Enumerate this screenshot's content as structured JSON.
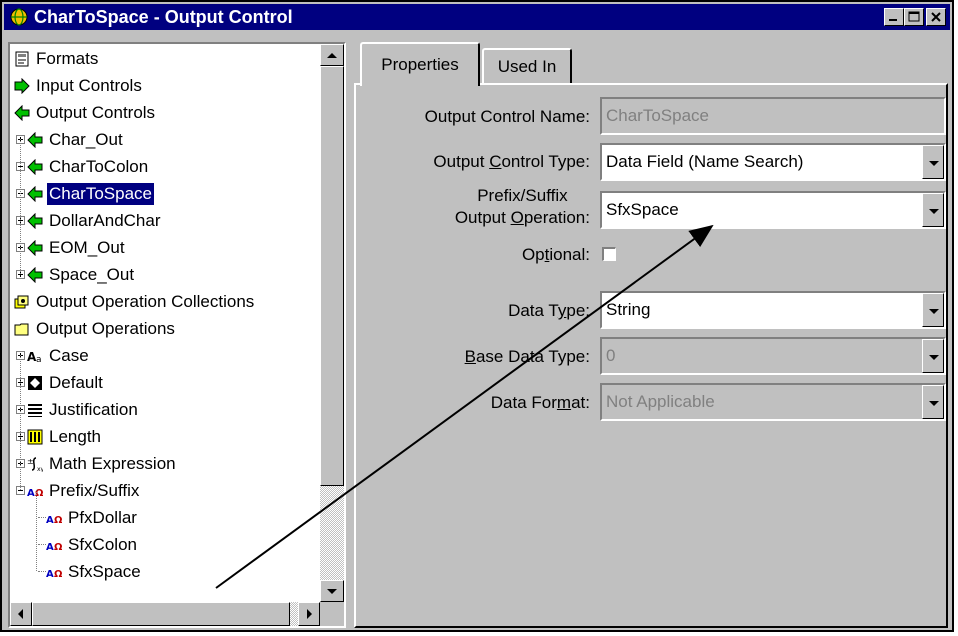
{
  "window": {
    "title": "CharToSpace - Output Control",
    "app_icon": "app-globe-icon",
    "controls": [
      "minimize-icon",
      "maximize-icon",
      "close-icon"
    ]
  },
  "tree": {
    "items": [
      {
        "label": "Formats",
        "icon": "formats-icon",
        "level": 0
      },
      {
        "label": "Input Controls",
        "icon": "input-controls-icon",
        "level": 0
      },
      {
        "label": "Output Controls",
        "icon": "output-controls-icon",
        "level": 0
      },
      {
        "label": "Char_Out",
        "icon": "output-control-icon",
        "level": 1,
        "expander": "plus"
      },
      {
        "label": "CharToColon",
        "icon": "output-control-icon",
        "level": 1,
        "expander": "minus"
      },
      {
        "label": "CharToSpace",
        "icon": "output-control-icon",
        "level": 1,
        "expander": "minus",
        "selected": true
      },
      {
        "label": "DollarAndChar",
        "icon": "output-control-icon",
        "level": 1,
        "expander": "plus"
      },
      {
        "label": "EOM_Out",
        "icon": "output-control-icon",
        "level": 1,
        "expander": "plus"
      },
      {
        "label": "Space_Out",
        "icon": "output-control-icon",
        "level": 1,
        "expander": "plus"
      },
      {
        "label": "Output Operation Collections",
        "icon": "collections-icon",
        "level": 0
      },
      {
        "label": "Output Operations",
        "icon": "folder-icon",
        "level": 0
      },
      {
        "label": "Case",
        "icon": "case-icon",
        "level": 1,
        "expander": "plus"
      },
      {
        "label": "Default",
        "icon": "default-icon",
        "level": 1,
        "expander": "plus"
      },
      {
        "label": "Justification",
        "icon": "justification-icon",
        "level": 1,
        "expander": "plus"
      },
      {
        "label": "Length",
        "icon": "length-icon",
        "level": 1,
        "expander": "plus"
      },
      {
        "label": "Math Expression",
        "icon": "math-expression-icon",
        "level": 1,
        "expander": "plus"
      },
      {
        "label": "Prefix/Suffix",
        "icon": "prefix-suffix-icon",
        "level": 1,
        "expander": "minus"
      },
      {
        "label": "PfxDollar",
        "icon": "prefix-suffix-icon",
        "level": 2
      },
      {
        "label": "SfxColon",
        "icon": "prefix-suffix-icon",
        "level": 2
      },
      {
        "label": "SfxSpace",
        "icon": "prefix-suffix-icon",
        "level": 2
      }
    ]
  },
  "tabs": [
    {
      "label": "Properties",
      "active": true
    },
    {
      "label": "Used In",
      "active": false
    }
  ],
  "properties": {
    "name_label": "Output Control Name:",
    "name_value": "CharToSpace",
    "type_label_pre": "Output ",
    "type_label_u": "C",
    "type_label_post": "ontrol Type:",
    "type_value": "Data Field (Name Search)",
    "prefix_label_line1": "Prefix/Suffix",
    "prefix_label_pre": "Output ",
    "prefix_label_u": "O",
    "prefix_label_post": "peration:",
    "prefix_value": "SfxSpace",
    "optional_label_pre": "Op",
    "optional_label_u": "t",
    "optional_label_post": "ional:",
    "optional_checked": false,
    "data_type_label_pre": "Data T",
    "data_type_label_u": "y",
    "data_type_label_post": "pe:",
    "data_type_value": "String",
    "base_type_label_u": "B",
    "base_type_label_post": "ase Data Type:",
    "base_type_value": "0",
    "format_label_pre": "Data For",
    "format_label_u": "m",
    "format_label_post": "at:",
    "format_value": "Not Applicable"
  },
  "colors": {
    "titlebar": "#000080",
    "selection": "#000080",
    "face": "#c0c0c0",
    "disabled_text": "#808080"
  }
}
